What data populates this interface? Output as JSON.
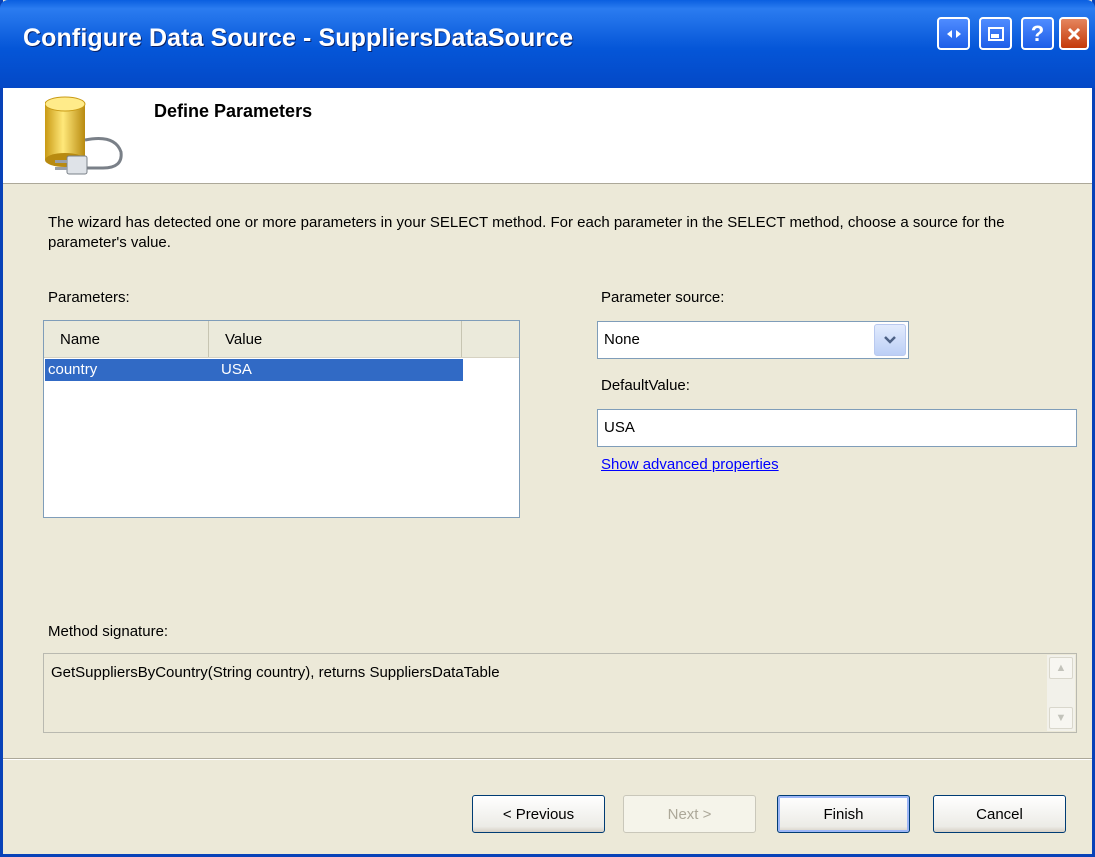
{
  "window": {
    "title": "Configure Data Source - SuppliersDataSource",
    "buttons": [
      "restore",
      "minimize",
      "help",
      "close"
    ]
  },
  "header": {
    "title": "Define Parameters",
    "icon": "database-plug-icon"
  },
  "intro": "The wizard has detected one or more parameters in your SELECT method. For each parameter in the SELECT method, choose a source for the parameter's value.",
  "parameters": {
    "label": "Parameters:",
    "columns": [
      "Name",
      "Value"
    ],
    "rows": [
      {
        "name": "country",
        "value": "USA",
        "selected": true
      }
    ]
  },
  "parameter_source": {
    "label": "Parameter source:",
    "value": "None"
  },
  "default_value": {
    "label": "DefaultValue:",
    "value": "USA"
  },
  "advanced_link": "Show advanced properties",
  "method_signature": {
    "label": "Method signature:",
    "value": "GetSuppliersByCountry(String country), returns SuppliersDataTable"
  },
  "footer": {
    "previous": "< Previous",
    "next": "Next >",
    "finish": "Finish",
    "cancel": "Cancel"
  },
  "colors": {
    "titlebar": "#0556d8",
    "selection": "#316ac5",
    "dialog_bg": "#ece9d8"
  }
}
